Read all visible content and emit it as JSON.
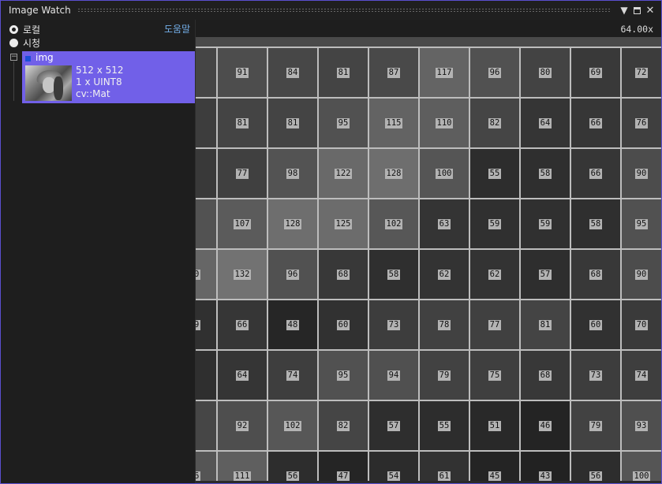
{
  "window": {
    "title": "Image Watch",
    "dropdown_icon": "triangle-down-icon",
    "maximize_icon": "maximize-icon",
    "close_icon": "close-icon",
    "dropdown_glyph": "▼",
    "close_glyph": "✕"
  },
  "left_panel": {
    "radio_local": "로컬",
    "radio_watch": "시청",
    "help_link": "도움말",
    "tree_toggle": "−",
    "image_item": {
      "name": "img",
      "dimensions": "512 x 512",
      "format": "1 x UINT8",
      "type": "cv::Mat"
    }
  },
  "viewer": {
    "zoom": "64.00x",
    "pixel_rows": [
      [
        91,
        84,
        81,
        87,
        117,
        96,
        80,
        69,
        72
      ],
      [
        81,
        81,
        95,
        115,
        110,
        82,
        64,
        66,
        76
      ],
      [
        77,
        98,
        122,
        128,
        100,
        55,
        58,
        66,
        90
      ],
      [
        107,
        128,
        125,
        102,
        63,
        59,
        59,
        58,
        95
      ],
      [
        132,
        96,
        68,
        58,
        62,
        62,
        57,
        68,
        90
      ],
      [
        66,
        48,
        60,
        73,
        78,
        77,
        81,
        60,
        70
      ],
      [
        64,
        74,
        95,
        94,
        79,
        75,
        68,
        73,
        74
      ],
      [
        92,
        102,
        82,
        57,
        55,
        51,
        46,
        79,
        93
      ],
      [
        111,
        56,
        47,
        54,
        61,
        45,
        43,
        56,
        100
      ]
    ],
    "left_partial_labels": [
      "",
      "",
      "",
      "",
      "0",
      "9",
      "",
      "",
      "6"
    ]
  }
}
